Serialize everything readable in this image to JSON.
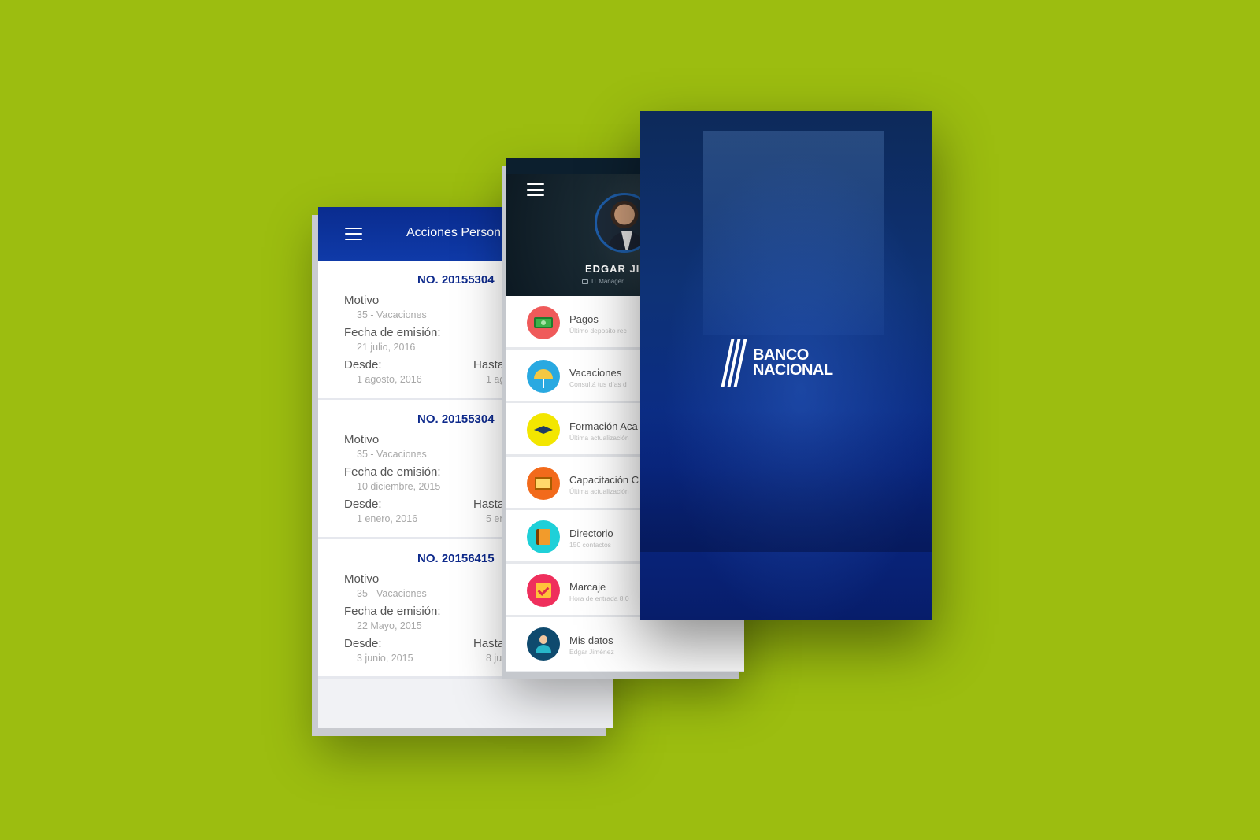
{
  "colors": {
    "background": "#9cbd10",
    "brand_blue": "#0e2a8c",
    "splash_blue": "#0a2a8a"
  },
  "acciones": {
    "title": "Acciones Person",
    "labels": {
      "motivo": "Motivo",
      "fecha_emision": "Fecha de emisión:",
      "desde": "Desde:",
      "hasta": "Hasta"
    },
    "records": [
      {
        "number": "NO. 20155304",
        "motivo": "35 - Vacaciones",
        "fecha_emision": "21 julio, 2016",
        "desde": "1 agosto, 2016",
        "hasta": "1 ag"
      },
      {
        "number": "NO. 20155304",
        "motivo": "35 - Vacaciones",
        "fecha_emision": "10 diciembre, 2015",
        "desde": "1 enero, 2016",
        "hasta": "5 en"
      },
      {
        "number": "NO. 20156415",
        "motivo": "35 - Vacaciones",
        "fecha_emision": "22 Mayo, 2015",
        "desde": "3 junio, 2015",
        "hasta": "8 ju"
      }
    ]
  },
  "menu": {
    "profile": {
      "name": "EDGAR JIM",
      "role": "IT Manager"
    },
    "items": [
      {
        "label": "Pagos",
        "sub": "Último deposito rec",
        "icon": "money-icon",
        "color": "#ef5a5a"
      },
      {
        "label": "Vacaciones",
        "sub": "Consultá tus días d",
        "icon": "umbrella-icon",
        "color": "#29a9e1"
      },
      {
        "label": "Formación Aca",
        "sub": "Última actualización",
        "icon": "graduation-cap-icon",
        "color": "#f3e600"
      },
      {
        "label": "Capacitación C",
        "sub": "Última actualización",
        "icon": "presentation-board-icon",
        "color": "#f26a1b"
      },
      {
        "label": "Directorio",
        "sub": "150 contactos",
        "icon": "phonebook-icon",
        "color": "#1fd0d8"
      },
      {
        "label": "Marcaje",
        "sub": "Hora de entrada 8:0",
        "icon": "checkbox-icon",
        "color": "#ef2f5c"
      },
      {
        "label": "Mis datos",
        "sub": "Edgar Jiménez",
        "icon": "user-icon",
        "color": "#0f4a6e"
      }
    ]
  },
  "splash": {
    "brand_line1": "BANCO",
    "brand_line2": "NACIONAL"
  }
}
